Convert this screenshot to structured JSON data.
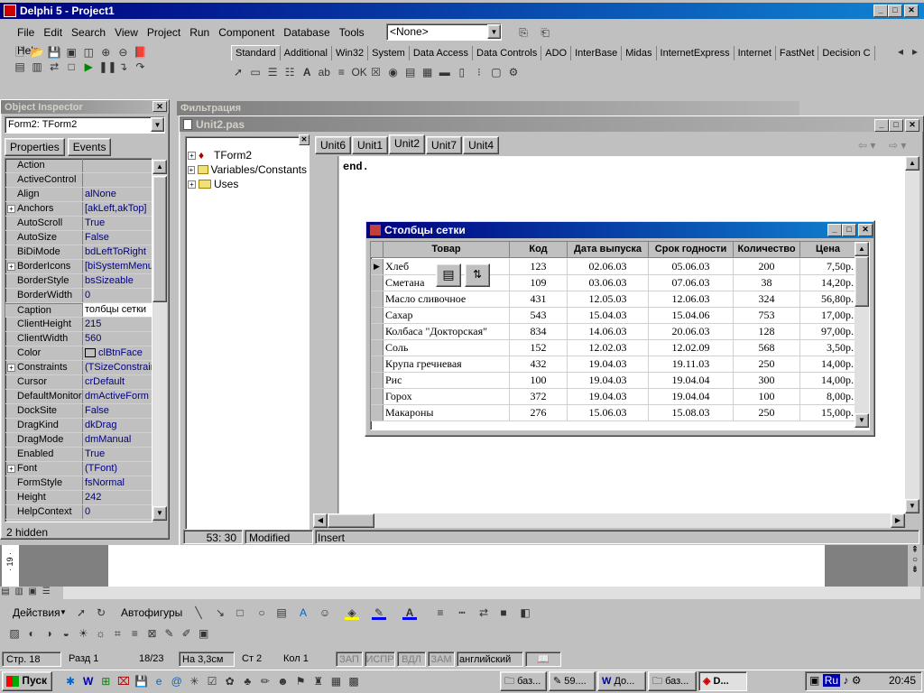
{
  "ide": {
    "title": "Delphi 5 - Project1",
    "menu": [
      "File",
      "Edit",
      "Search",
      "View",
      "Project",
      "Run",
      "Component",
      "Database",
      "Tools",
      "Help"
    ],
    "config_select": "<None>",
    "palette_tabs": [
      "Standard",
      "Additional",
      "Win32",
      "System",
      "Data Access",
      "Data Controls",
      "ADO",
      "InterBase",
      "Midas",
      "InternetExpress",
      "Internet",
      "FastNet",
      "Decision C"
    ]
  },
  "bg_caption_fragment": "Фильтрация",
  "object_inspector": {
    "title": "Object Inspector",
    "object": "Form2: TForm2",
    "tabs": [
      "Properties",
      "Events"
    ],
    "rows": [
      {
        "p": "Action",
        "v": "",
        "plus": false
      },
      {
        "p": "ActiveControl",
        "v": "",
        "plus": false
      },
      {
        "p": "Align",
        "v": "alNone",
        "plus": false
      },
      {
        "p": "Anchors",
        "v": "[akLeft,akTop]",
        "plus": true
      },
      {
        "p": "AutoScroll",
        "v": "True",
        "plus": false
      },
      {
        "p": "AutoSize",
        "v": "False",
        "plus": false
      },
      {
        "p": "BiDiMode",
        "v": "bdLeftToRight",
        "plus": false
      },
      {
        "p": "BorderIcons",
        "v": "[biSystemMenu,",
        "plus": true
      },
      {
        "p": "BorderStyle",
        "v": "bsSizeable",
        "plus": false
      },
      {
        "p": "BorderWidth",
        "v": "0",
        "plus": false
      },
      {
        "p": "Caption",
        "v": "толбцы сетки",
        "plus": false,
        "sel": true
      },
      {
        "p": "ClientHeight",
        "v": "215",
        "plus": false
      },
      {
        "p": "ClientWidth",
        "v": "560",
        "plus": false
      },
      {
        "p": "Color",
        "v": "clBtnFace",
        "plus": false,
        "swatch": true
      },
      {
        "p": "Constraints",
        "v": "(TSizeConstrain",
        "plus": true
      },
      {
        "p": "Cursor",
        "v": "crDefault",
        "plus": false
      },
      {
        "p": "DefaultMonitor",
        "v": "dmActiveForm",
        "plus": false
      },
      {
        "p": "DockSite",
        "v": "False",
        "plus": false
      },
      {
        "p": "DragKind",
        "v": "dkDrag",
        "plus": false
      },
      {
        "p": "DragMode",
        "v": "dmManual",
        "plus": false
      },
      {
        "p": "Enabled",
        "v": "True",
        "plus": false
      },
      {
        "p": "Font",
        "v": "(TFont)",
        "plus": true
      },
      {
        "p": "FormStyle",
        "v": "fsNormal",
        "plus": false
      },
      {
        "p": "Height",
        "v": "242",
        "plus": false
      },
      {
        "p": "HelpContext",
        "v": "0",
        "plus": false
      }
    ],
    "status": "2 hidden"
  },
  "editor": {
    "title": "Unit2.pas",
    "tree": [
      "TForm2",
      "Variables/Constants",
      "Uses"
    ],
    "tabs": [
      "Unit6",
      "Unit1",
      "Unit2",
      "Unit7",
      "Unit4"
    ],
    "active_tab": 2,
    "code": "end.",
    "status_pos": "53: 30",
    "status_mod": "Modified",
    "status_ins": "Insert"
  },
  "form": {
    "title": "Столбцы сетки",
    "columns": [
      "Товар",
      "Код",
      "Дата выпуска",
      "Срок годности",
      "Количество",
      "Цена"
    ],
    "rows": [
      [
        "Хлеб",
        "123",
        "02.06.03",
        "05.06.03",
        "200",
        "7,50р."
      ],
      [
        "Сметана",
        "109",
        "03.06.03",
        "07.06.03",
        "38",
        "14,20р."
      ],
      [
        "Масло сливочное",
        "431",
        "12.05.03",
        "12.06.03",
        "324",
        "56,80р."
      ],
      [
        "Сахар",
        "543",
        "15.04.03",
        "15.04.06",
        "753",
        "17,00р."
      ],
      [
        "Колбаса \"Докторская\"",
        "834",
        "14.06.03",
        "20.06.03",
        "128",
        "97,00р."
      ],
      [
        "Соль",
        "152",
        "12.02.03",
        "12.02.09",
        "568",
        "3,50р."
      ],
      [
        "Крупа гречневая",
        "432",
        "19.04.03",
        "19.11.03",
        "250",
        "14,00р."
      ],
      [
        "Рис",
        "100",
        "19.04.03",
        "19.04.04",
        "300",
        "14,00р."
      ],
      [
        "Горох",
        "372",
        "19.04.03",
        "19.04.04",
        "100",
        "8,00р."
      ],
      [
        "Макароны",
        "276",
        "15.06.03",
        "15.08.03",
        "250",
        "15,00р."
      ]
    ]
  },
  "word": {
    "draw_actions": "Действия",
    "autoshapes": "Автофигуры",
    "status": {
      "page": "Стр. 18",
      "section": "Разд 1",
      "pages": "18/23",
      "at": "На 3,3см",
      "line": "Ст 2",
      "col": "Кол 1",
      "rec": "ЗАП",
      "trk": "ИСПР",
      "ext": "ВДЛ",
      "ovr": "ЗАМ",
      "lang": "английский"
    },
    "ruler_mark": "· 19 ·"
  },
  "taskbar": {
    "start": "Пуск",
    "buttons": [
      "баз...",
      "59....",
      "До...",
      "баз...",
      "D..."
    ],
    "lang": "Ru",
    "clock": "20:45"
  }
}
